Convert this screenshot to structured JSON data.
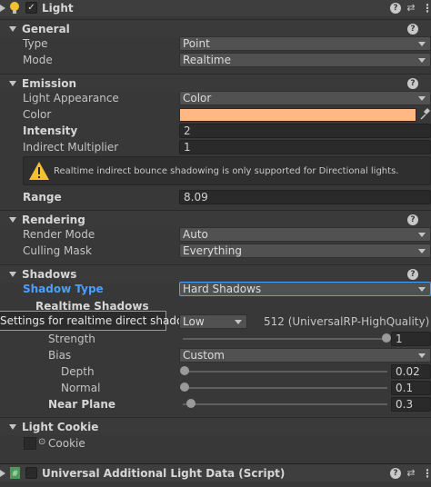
{
  "header": {
    "title": "Light",
    "enabled": true
  },
  "general": {
    "title": "General",
    "type_label": "Type",
    "type_value": "Point",
    "mode_label": "Mode",
    "mode_value": "Realtime"
  },
  "emission": {
    "title": "Emission",
    "appearance_label": "Light Appearance",
    "appearance_value": "Color",
    "color_label": "Color",
    "color_value": "#fdb885",
    "intensity_label": "Intensity",
    "intensity_value": "2",
    "indirect_label": "Indirect Multiplier",
    "indirect_value": "1",
    "warning": "Realtime indirect bounce shadowing is only supported for Directional lights.",
    "range_label": "Range",
    "range_value": "8.09"
  },
  "rendering": {
    "title": "Rendering",
    "render_mode_label": "Render Mode",
    "render_mode_value": "Auto",
    "culling_label": "Culling Mask",
    "culling_value": "Everything"
  },
  "shadows": {
    "title": "Shadows",
    "shadow_type_label": "Shadow Type",
    "shadow_type_value": "Hard Shadows",
    "realtime_label": "Realtime Shadows",
    "tooltip": "Settings for realtime direct shadows.",
    "resolution_value": "Low",
    "resolution_info": "512 (UniversalRP-HighQuality)",
    "strength_label": "Strength",
    "strength_value": "1",
    "strength_fraction": 1.0,
    "bias_label": "Bias",
    "bias_value": "Custom",
    "depth_label": "Depth",
    "depth_value": "0.02",
    "depth_fraction": 0.0,
    "normal_label": "Normal",
    "normal_value": "0.1",
    "normal_fraction": 0.0,
    "near_label": "Near Plane",
    "near_value": "0.3",
    "near_fraction": 0.03
  },
  "cookie": {
    "title": "Light Cookie",
    "cookie_label": "Cookie"
  },
  "footer": {
    "title": "Universal Additional Light Data (Script)"
  },
  "colors": {
    "accent_blue": "#4c9eff",
    "warning_yellow": "#f2c12e",
    "light_color": "#fdb885"
  }
}
